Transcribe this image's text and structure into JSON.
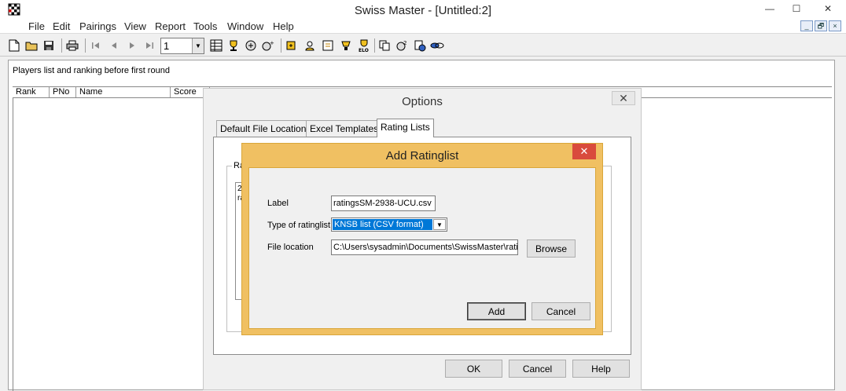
{
  "window": {
    "title": "Swiss Master - [Untitled:2]",
    "minimize_glyph": "—",
    "maximize_glyph": "☐",
    "close_glyph": "✕"
  },
  "menu": [
    "File",
    "Edit",
    "Pairings",
    "View",
    "Report",
    "Tools",
    "Window",
    "Help"
  ],
  "mdi_controls": [
    "_",
    "🗗",
    "×"
  ],
  "toolbar": {
    "round_value": "1",
    "dropdown_glyph": "▼",
    "icons": [
      "new-file-icon",
      "open-folder-icon",
      "save-icon",
      "print-icon",
      "first-icon",
      "prev-icon",
      "next-icon",
      "last-icon",
      "table-icon",
      "trophy-icon",
      "pairing-icon",
      "pairing-auto-icon",
      "player-add-icon",
      "player-edit-icon",
      "player-search-icon",
      "player-list-icon",
      "elo-icon",
      "copy-icon",
      "settings-icon",
      "globe-icon",
      "link-icon"
    ]
  },
  "document": {
    "caption": "Players list and ranking before first round",
    "columns": [
      "Rank",
      "PNo",
      "Name",
      "Score"
    ]
  },
  "options_dialog": {
    "title": "Options",
    "close_glyph": "✕",
    "tabs": [
      "Default File Locations",
      "Excel Templates",
      "Rating Lists"
    ],
    "active_tab": "Rating Lists",
    "group_caption": "Ra",
    "list_fragments": [
      "2",
      "ra"
    ],
    "buttons": {
      "ok": "OK",
      "cancel": "Cancel",
      "help": "Help"
    }
  },
  "add_dialog": {
    "title": "Add Ratinglist",
    "close_glyph": "✕",
    "label_caption": "Label",
    "label_value": "ratingsSM-2938-UCU.csv",
    "type_caption": "Type of ratinglist",
    "type_value": "KNSB list (CSV format)",
    "location_caption": "File location",
    "location_value": "C:\\Users\\sysadmin\\Documents\\SwissMaster\\rati",
    "browse": "Browse",
    "add": "Add",
    "cancel": "Cancel",
    "dropdown_glyph": "▼"
  },
  "colors": {
    "add_dialog_frame": "#f0c062",
    "close_red": "#d94b3d",
    "selection_blue": "#0078d7"
  }
}
